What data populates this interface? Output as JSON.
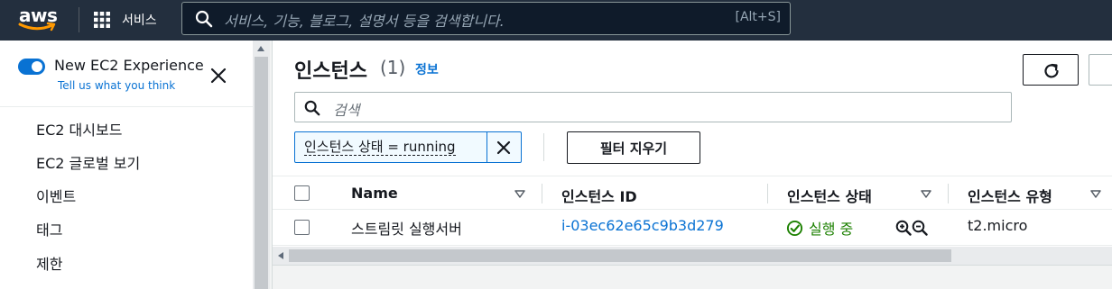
{
  "topbar": {
    "logo_text": "aws",
    "services_label": "서비스",
    "search_placeholder": "서비스, 기능, 블로그, 설명서 등을 검색합니다.",
    "search_shortcut": "[Alt+S]"
  },
  "sidebar": {
    "new_experience_label": "New EC2 Experience",
    "feedback_link": "Tell us what you think",
    "new_experience_enabled": true,
    "items": [
      {
        "label": "EC2 대시보드"
      },
      {
        "label": "EC2 글로벌 보기"
      },
      {
        "label": "이벤트"
      },
      {
        "label": "태그"
      },
      {
        "label": "제한"
      }
    ]
  },
  "main": {
    "title": "인스턴스",
    "count": "(1)",
    "info_link": "정보",
    "search_placeholder": "검색",
    "filter_token": "인스턴스 상태 = running",
    "clear_filters_label": "필터 지우기",
    "columns": [
      "Name",
      "인스턴스 ID",
      "인스턴스 상태",
      "인스턴스 유형"
    ],
    "rows": [
      {
        "name": "스트림릿 실행서버",
        "instance_id": "i-03ec62e65c9b3d279",
        "state": "실행 중",
        "type": "t2.micro"
      }
    ]
  },
  "colors": {
    "topbar_bg": "#232f3e",
    "link": "#0972d3",
    "running": "#1d8102"
  }
}
